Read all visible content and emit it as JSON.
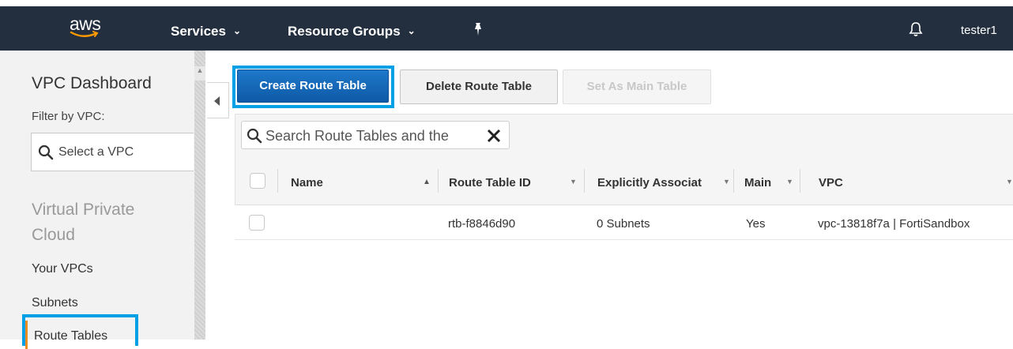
{
  "topnav": {
    "logo_text": "aws",
    "services_label": "Services",
    "resource_groups_label": "Resource Groups",
    "user": "tester1"
  },
  "sidebar": {
    "title": "VPC Dashboard",
    "filter_label": "Filter by VPC:",
    "vpc_select_placeholder": "Select a VPC",
    "section_title": "Virtual Private Cloud",
    "items": [
      {
        "label": "Your VPCs"
      },
      {
        "label": "Subnets"
      },
      {
        "label": "Route Tables"
      }
    ]
  },
  "actions": {
    "create": "Create Route Table",
    "delete": "Delete Route Table",
    "set_main": "Set As Main Table"
  },
  "search": {
    "placeholder": "Search Route Tables and the"
  },
  "table": {
    "columns": [
      "Name",
      "Route Table ID",
      "Explicitly Associat",
      "Main",
      "VPC"
    ],
    "rows": [
      {
        "name": "",
        "route_table_id": "rtb-f8846d90",
        "explicitly_associated": "0 Subnets",
        "main": "Yes",
        "vpc": "vpc-13818f7a | FortiSandbox"
      }
    ]
  },
  "colors": {
    "nav_bg": "#232f3e",
    "primary_button": "#1166bb",
    "highlight_outline": "#00a0e6",
    "active_bar": "#ec8b1f"
  }
}
